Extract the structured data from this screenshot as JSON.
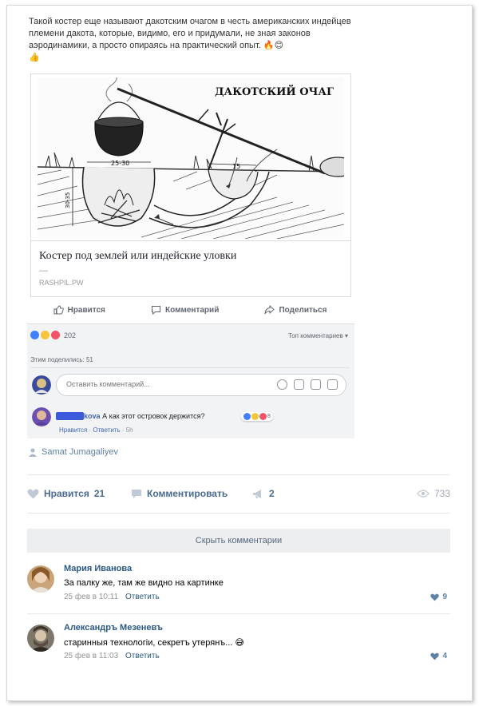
{
  "post": {
    "text": "Такой костер еще называют дакотским очагом в честь американских индейцев племени дакота, которые, видимо, его и придумали, не зная законов аэродинамики, а просто опираясь на практический опыт."
  },
  "card": {
    "illustration_title": "ДАКОТСКИЙ ОЧАГ",
    "dim_left": "25-30",
    "dim_right": "15",
    "dim_vertical": "30-35",
    "title": "Костер под землей или индейские уловки",
    "dash": "—",
    "source": "RASHPIL.PW"
  },
  "fb": {
    "actions": {
      "like": "Нравится",
      "comment": "Комментарий",
      "share": "Поделиться"
    },
    "reactions_count": "202",
    "top_comments": "Топ комментариев ▾",
    "shared": "Этим поделились: 51",
    "comment_placeholder": "Оставить комментарий...",
    "comment": {
      "name_suffix": "kova",
      "text": "А как этот островок держится?",
      "reactions_count": "8",
      "like": "Нравится",
      "reply": "Ответить",
      "time": "5h"
    }
  },
  "vk": {
    "author": "Samat Jumagaliyev",
    "like_label": "Нравится",
    "like_count": "21",
    "comment_label": "Комментировать",
    "share_count": "2",
    "views": "733",
    "hide_comments": "Скрыть комментарии",
    "comments": [
      {
        "name": "Мария Иванова",
        "text": "За палку же, там же видно на картинке",
        "date": "25 фев в 10:11",
        "reply": "Ответить",
        "likes": "9"
      },
      {
        "name": "Александръ Мезеневъ",
        "text": "старинныя технологіи, секретъ утерянъ...",
        "date": "25 фев в 11:03",
        "reply": "Ответить",
        "likes": "4"
      }
    ]
  },
  "colors": {
    "vk_link": "#2a5885",
    "fb_blue": "#4267b2",
    "like_reaction": "#4080ff",
    "love_reaction": "#f25268",
    "wow_reaction": "#f7c53a"
  }
}
